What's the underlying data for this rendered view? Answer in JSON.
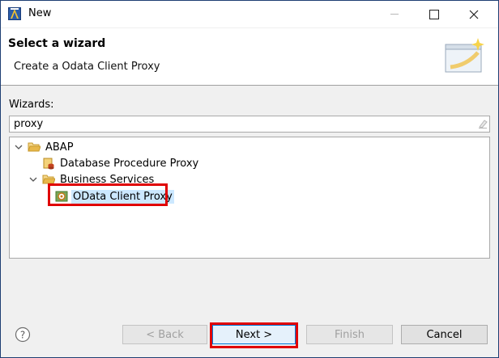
{
  "window": {
    "title": "New",
    "controls": {
      "minimize_icon": "minimize-icon",
      "maximize_icon": "maximize-icon",
      "close_icon": "close-icon"
    }
  },
  "header": {
    "title": "Select a wizard",
    "description": "Create a Odata Client Proxy",
    "image_icon": "wizard-banner-icon"
  },
  "wizards": {
    "label": "Wizards:",
    "filter_value": "proxy",
    "tree": [
      {
        "label": "ABAP",
        "icon": "folder-open-icon",
        "expanded": true
      },
      {
        "label": "Database Procedure Proxy",
        "icon": "database-procedure-proxy-icon"
      },
      {
        "label": "Business Services",
        "icon": "folder-open-icon",
        "expanded": true
      },
      {
        "label": "OData Client Proxy",
        "icon": "odata-client-proxy-icon",
        "selected": true
      }
    ]
  },
  "footer": {
    "help_icon": "help-icon",
    "back_label": "< Back",
    "next_label": "Next >",
    "finish_label": "Finish",
    "cancel_label": "Cancel"
  },
  "colors": {
    "highlight": "#e00000",
    "selection": "#cce8ff",
    "folder": "#e8b84a",
    "default_button_border": "#0078d7"
  }
}
